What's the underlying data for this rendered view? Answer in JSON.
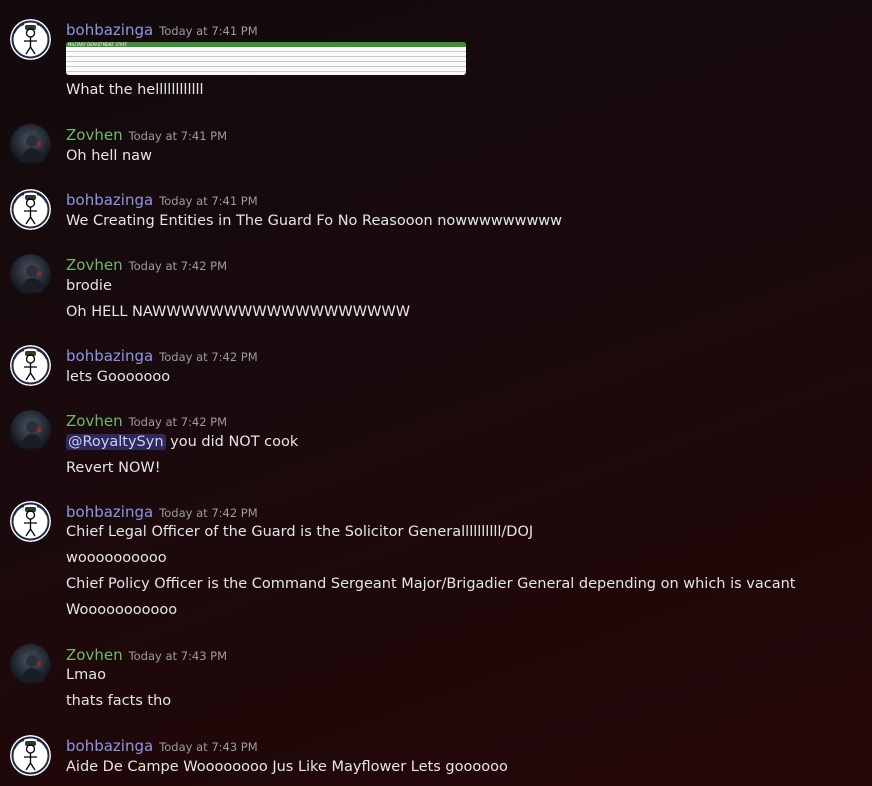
{
  "users": {
    "boh": {
      "name": "bohbazinga",
      "color": "#8c97e4"
    },
    "zov": {
      "name": "Zovhen",
      "color": "#6fb86c"
    }
  },
  "attachment": {
    "title": "MILITARY DEPARTMENT STAFF"
  },
  "messages": [
    {
      "author": "bohbazinga",
      "time": "Today at 7:41 PM",
      "lines": [
        "What the hellllllllllll"
      ]
    },
    {
      "author": "Zovhen",
      "time": "Today at 7:41 PM",
      "lines": [
        "Oh hell naw"
      ]
    },
    {
      "author": "bohbazinga",
      "time": "Today at 7:41 PM",
      "lines": [
        "We Creating Entities in The Guard Fo No Reasooon nowwwwwwwww"
      ]
    },
    {
      "author": "Zovhen",
      "time": "Today at 7:42 PM",
      "lines": [
        "brodie",
        "Oh HELL NAWWWWWWWWWWWWWWWWWW"
      ]
    },
    {
      "author": "bohbazinga",
      "time": "Today at 7:42 PM",
      "lines": [
        "lets Gooooooo"
      ]
    },
    {
      "author": "Zovhen",
      "time": "Today at 7:42 PM",
      "mention": "@RoyaltySyn",
      "lines": [
        " you did NOT cook",
        "Revert NOW!"
      ]
    },
    {
      "author": "bohbazinga",
      "time": "Today at 7:42 PM",
      "lines": [
        "Chief Legal Officer of the Guard is the Solicitor Generallllllllll/DOJ",
        "woooooooooo",
        "Chief Policy Officer is the Command Sergeant Major/Brigadier General depending on which is vacant",
        "Wooooooooooo"
      ]
    },
    {
      "author": "Zovhen",
      "time": "Today at 7:43 PM",
      "lines": [
        "Lmao",
        "thats facts tho"
      ]
    },
    {
      "author": "bohbazinga",
      "time": "Today at 7:43 PM",
      "lines": [
        "Aide De Campe Woooooooo Jus Like Mayflower Lets goooooo"
      ]
    }
  ]
}
